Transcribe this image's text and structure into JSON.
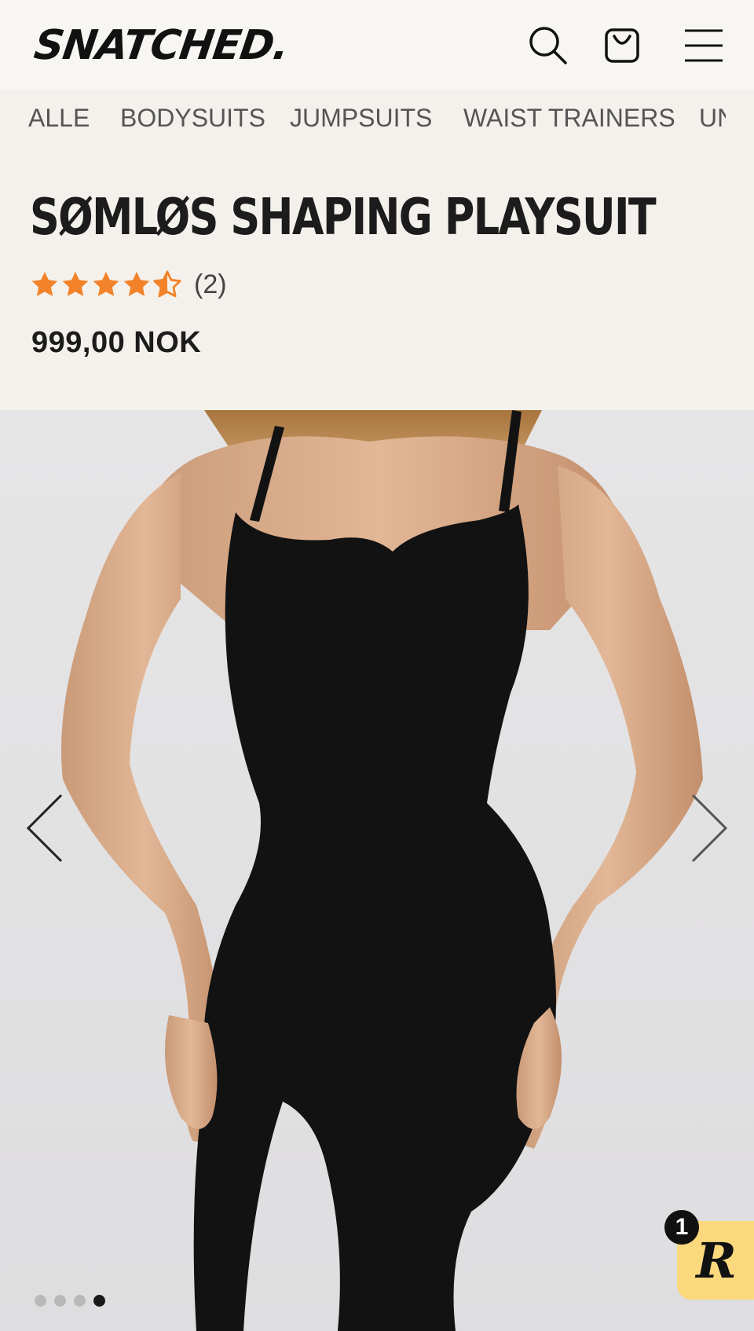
{
  "brand": {
    "logo_text": "SNATCHED."
  },
  "header": {
    "icons": [
      "search-icon",
      "shopping-bag-icon",
      "hamburger-menu-icon"
    ]
  },
  "nav": {
    "items": [
      {
        "label": "ALLE"
      },
      {
        "label": "BODYSUITS"
      },
      {
        "label": "JUMPSUITS"
      },
      {
        "label": "WAIST TRAINERS"
      },
      {
        "label": "UN"
      }
    ]
  },
  "product": {
    "title": "SØMLØS SHAPING PLAYSUIT",
    "rating": 4.5,
    "rating_max": 5,
    "review_count": "(2)",
    "price": "999,00 NOK"
  },
  "gallery": {
    "image_count": 4,
    "active_index": 4,
    "prev_icon": "chevron-left-icon",
    "next_icon": "chevron-right-icon"
  },
  "rewards_widget": {
    "letter": "R",
    "badge_count": "1"
  },
  "colors": {
    "background": "#f4f1ec",
    "header": "#f8f6f3",
    "star": "#f2832a",
    "rewards": "#fcd97d",
    "text": "#1c1c1c"
  }
}
